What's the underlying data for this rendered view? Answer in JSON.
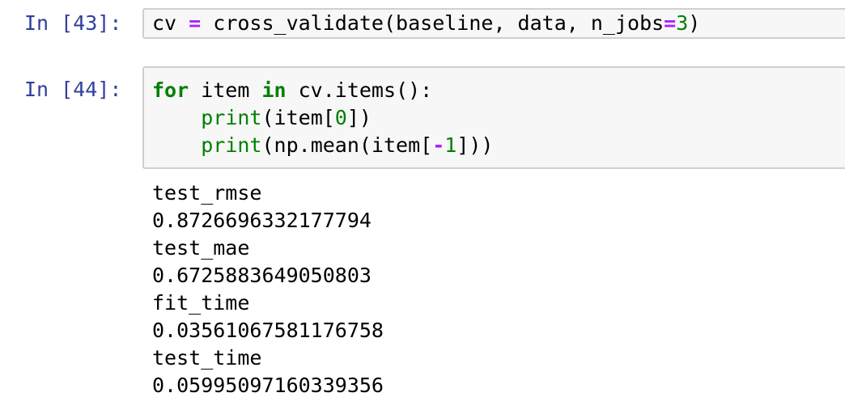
{
  "cells": [
    {
      "prompt": "In [43]:",
      "code": {
        "tokens": [
          "cv ",
          "=",
          " cross_validate(baseline, data, n_jobs",
          "=",
          "3",
          ")"
        ]
      }
    },
    {
      "prompt": "In [44]:",
      "code": {
        "line1": [
          "for",
          " item ",
          "in",
          " cv.items():"
        ],
        "line2": [
          "    ",
          "print",
          "(item[",
          "0",
          "])"
        ],
        "line3": [
          "    ",
          "print",
          "(np.mean(item[",
          "-",
          "1",
          "]))"
        ]
      },
      "output": [
        "test_rmse",
        "0.8726696332177794",
        "test_mae",
        "0.6725883649050803",
        "fit_time",
        "0.03561067581176758",
        "test_time",
        "0.05995097160339356"
      ]
    }
  ],
  "colors": {
    "prompt": "#303f9f",
    "keyword": "#008000",
    "operator": "#aa22ff",
    "number": "#008000",
    "cell_background": "#f7f7f7",
    "cell_border": "#cfcfcf"
  }
}
